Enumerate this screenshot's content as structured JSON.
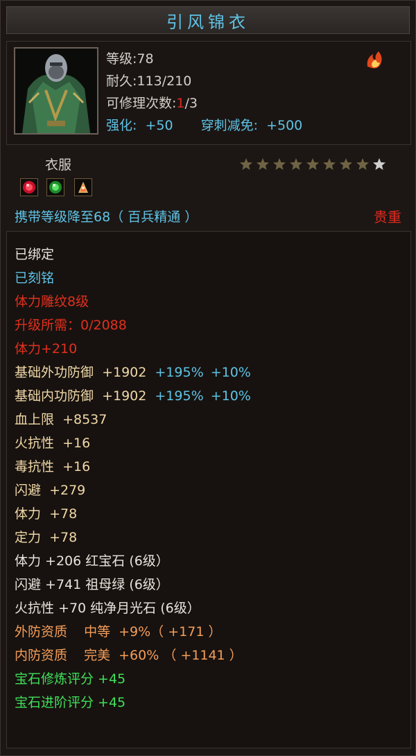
{
  "title": "引风锦衣",
  "top": {
    "level_label": "等级:",
    "level_value": "78",
    "durability_label": "耐久:",
    "durability_value": "113/210",
    "repair_label": "可修理次数:",
    "repair_used": "1",
    "repair_total": "/3",
    "enhance_label": "强化:",
    "enhance_value": "+50",
    "pierce_label": "穿刺减免:",
    "pierce_value": "+500",
    "icon": "flame-wing-icon"
  },
  "category": "衣服",
  "stars": {
    "filled": 8,
    "total": 9
  },
  "gems": [
    "ruby-gem-icon",
    "emerald-gem-icon",
    "moonstone-gem-icon"
  ],
  "carry_text": "携带等级降至68（ 百兵精通 ）",
  "rarity": "贵重",
  "attributes": {
    "bound": "已绑定",
    "engraved": "已刻铭",
    "carving": "体力雕纹8级",
    "upgrade_label": "升级所需：",
    "upgrade_value": "0/2088",
    "stamina_bonus": "体力+210",
    "ext_def_label": "基础外功防御",
    "ext_def_value": "+1902",
    "ext_def_pct1": "+195%",
    "ext_def_pct2": "+10%",
    "int_def_label": "基础内功防御",
    "int_def_value": "+1902",
    "int_def_pct1": "+195%",
    "int_def_pct2": "+10%",
    "hp_label": "血上限",
    "hp_value": "+8537",
    "fire_label": "火抗性",
    "fire_value": "+16",
    "poison_label": "毒抗性",
    "poison_value": "+16",
    "dodge_label": "闪避",
    "dodge_value": "+279",
    "stamina_label": "体力",
    "stamina_value": "+78",
    "focus_label": "定力",
    "focus_value": "+78",
    "gem1": "体力 +206 红宝石 (6级）",
    "gem2": "闪避 +741 祖母绿 (6级）",
    "gem3": "火抗性 +70 纯净月光石 (6级）",
    "ext_quality_label": "外防资质",
    "ext_quality_grade": "中等",
    "ext_quality_value": "+9%（ +171 ）",
    "int_quality_label": "内防资质",
    "int_quality_grade": "完美",
    "int_quality_value": "+60% （ +1141 ）",
    "gem_refine": "宝石修炼评分 +45",
    "gem_advance": "宝石进阶评分 +45"
  }
}
